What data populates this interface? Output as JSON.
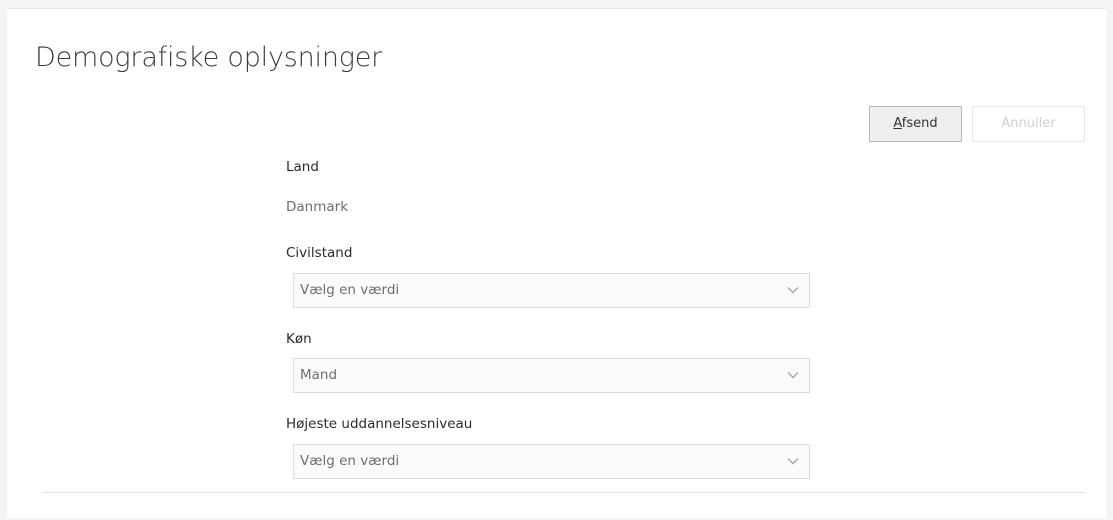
{
  "page": {
    "title": "Demografiske oplysninger"
  },
  "actions": {
    "submit_key": "A",
    "submit_rest": "fsend",
    "cancel_label": "Annuller"
  },
  "fields": {
    "country": {
      "label": "Land",
      "value": "Danmark"
    },
    "marital_status": {
      "label": "Civilstand",
      "value": "Vælg en værdi"
    },
    "gender": {
      "label": "Køn",
      "value": "Mand"
    },
    "education": {
      "label": "Højeste uddannelsesniveau",
      "value": "Vælg en værdi"
    }
  },
  "icons": {
    "dropdown": "chevron-down-icon"
  },
  "colors": {
    "text_primary": "#2b2b2b",
    "text_muted": "#6e6e6e",
    "disabled": "#cfcfcf"
  }
}
